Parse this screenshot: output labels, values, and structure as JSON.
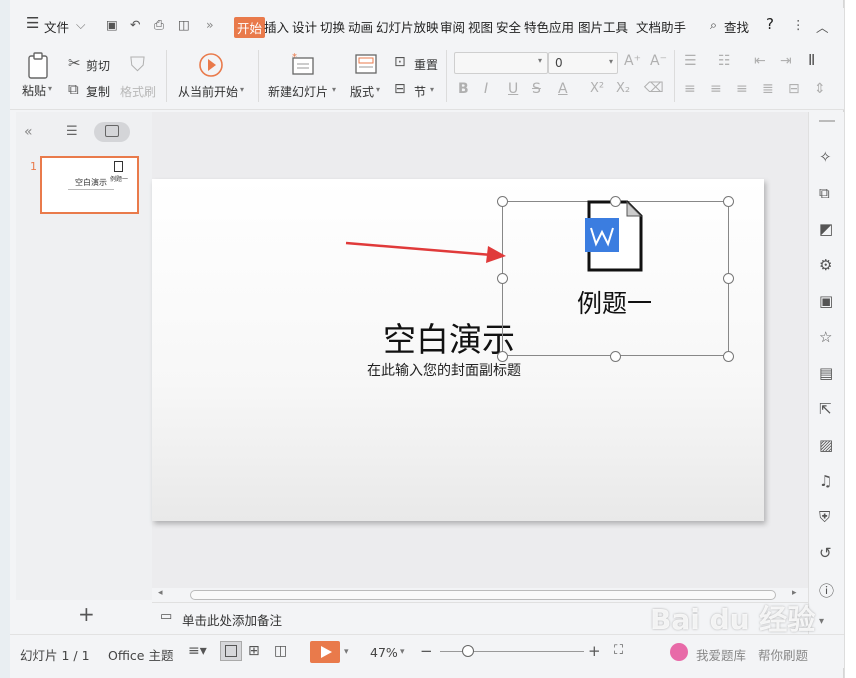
{
  "menu": {
    "file": "文件",
    "tabs": [
      "开始",
      "插入",
      "设计",
      "切换",
      "动画",
      "幻灯片放映",
      "审阅",
      "视图",
      "安全",
      "特色应用",
      "图片工具",
      "文档助手"
    ],
    "search": "查找",
    "help": "?"
  },
  "ribbon": {
    "paste": "粘贴",
    "cut": "剪切",
    "copy": "复制",
    "format_painter": "格式刷",
    "play_from_current": "从当前开始",
    "new_slide": "新建幻灯片",
    "layout": "版式",
    "reset": "重置",
    "section": "节",
    "font_size": "0",
    "font_style_buttons": [
      "B",
      "I",
      "U",
      "S",
      "A",
      "X²",
      "X₂"
    ]
  },
  "slide": {
    "number": "1",
    "title": "空白演示",
    "subtitle": "在此输入您的封面副标题",
    "object_label": "例题一",
    "thumb_title": "空白演示",
    "thumb_object_label": "例题一"
  },
  "notes": {
    "placeholder": "单击此处添加备注"
  },
  "status": {
    "slide_counter": "幻灯片 1 / 1",
    "theme": "Office 主题",
    "zoom": "47%",
    "watermark": "Bai du 经验",
    "right_text_1": "我爱题库",
    "right_text_2": "帮你刷题"
  },
  "colors": {
    "accent": "#e97a4b",
    "arrow": "#e03a3a",
    "word_icon": "#3b7de0"
  }
}
